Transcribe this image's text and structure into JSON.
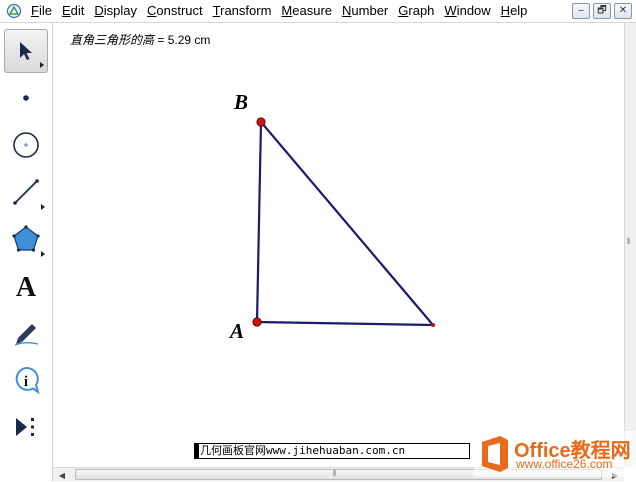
{
  "menubar": {
    "app_icon": "sketchpad-app-icon",
    "items": [
      {
        "key": "F",
        "rest": "ile"
      },
      {
        "key": "E",
        "rest": "dit"
      },
      {
        "key": "D",
        "rest": "isplay"
      },
      {
        "key": "C",
        "rest": "onstruct"
      },
      {
        "key": "T",
        "rest": "ransform"
      },
      {
        "key": "M",
        "rest": "easure"
      },
      {
        "key": "N",
        "rest": "umber"
      },
      {
        "key": "G",
        "rest": "raph"
      },
      {
        "key": "W",
        "rest": "indow"
      },
      {
        "key": "H",
        "rest": "elp"
      }
    ],
    "window_buttons": {
      "minimize": "–",
      "restore": "🗗",
      "close": "✕"
    }
  },
  "toolbox": {
    "tools": [
      "arrow-select",
      "point",
      "compass",
      "straightedge",
      "polygon",
      "text",
      "marker",
      "information",
      "custom"
    ]
  },
  "sketch": {
    "measurement": {
      "name": "直角三角形的高",
      "eq": " = ",
      "value": "5.29",
      "unit": "cm"
    },
    "points": {
      "A": "A",
      "B": "B"
    },
    "colors": {
      "segment": "#1a1a6e",
      "point": "#cc1111"
    }
  },
  "watermark": {
    "site": "几何画板官网www.jihehuaban.com.cn",
    "brand": "Office教程网",
    "brand_url": "www.office26.com"
  },
  "scroll": {
    "grip": "⦀"
  }
}
